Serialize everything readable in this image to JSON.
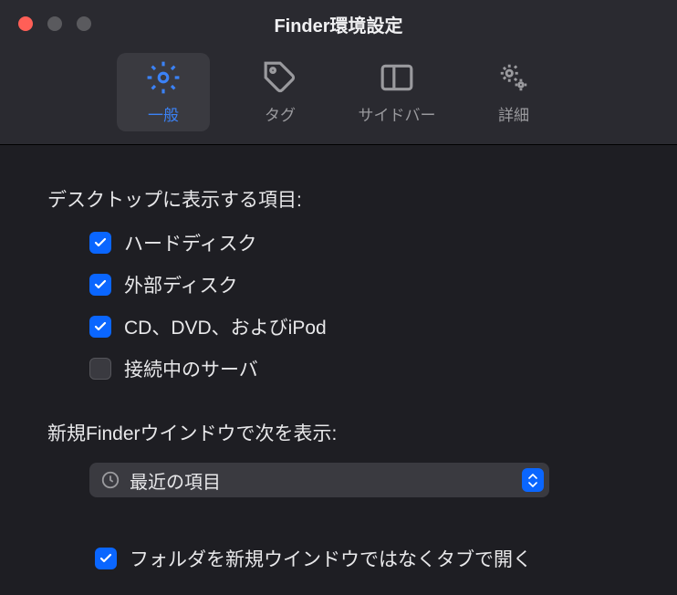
{
  "window": {
    "title": "Finder環境設定"
  },
  "tabs": {
    "general": "一般",
    "tags": "タグ",
    "sidebar": "サイドバー",
    "advanced": "詳細"
  },
  "desktop_section": {
    "label": "デスクトップに表示する項目:",
    "items": [
      {
        "label": "ハードディスク",
        "checked": true
      },
      {
        "label": "外部ディスク",
        "checked": true
      },
      {
        "label": "CD、DVD、およびiPod",
        "checked": true
      },
      {
        "label": "接続中のサーバ",
        "checked": false
      }
    ]
  },
  "new_window_section": {
    "label": "新規Finderウインドウで次を表示:",
    "selected": "最近の項目"
  },
  "tabs_pref": {
    "label": "フォルダを新規ウインドウではなくタブで開く",
    "checked": true
  }
}
